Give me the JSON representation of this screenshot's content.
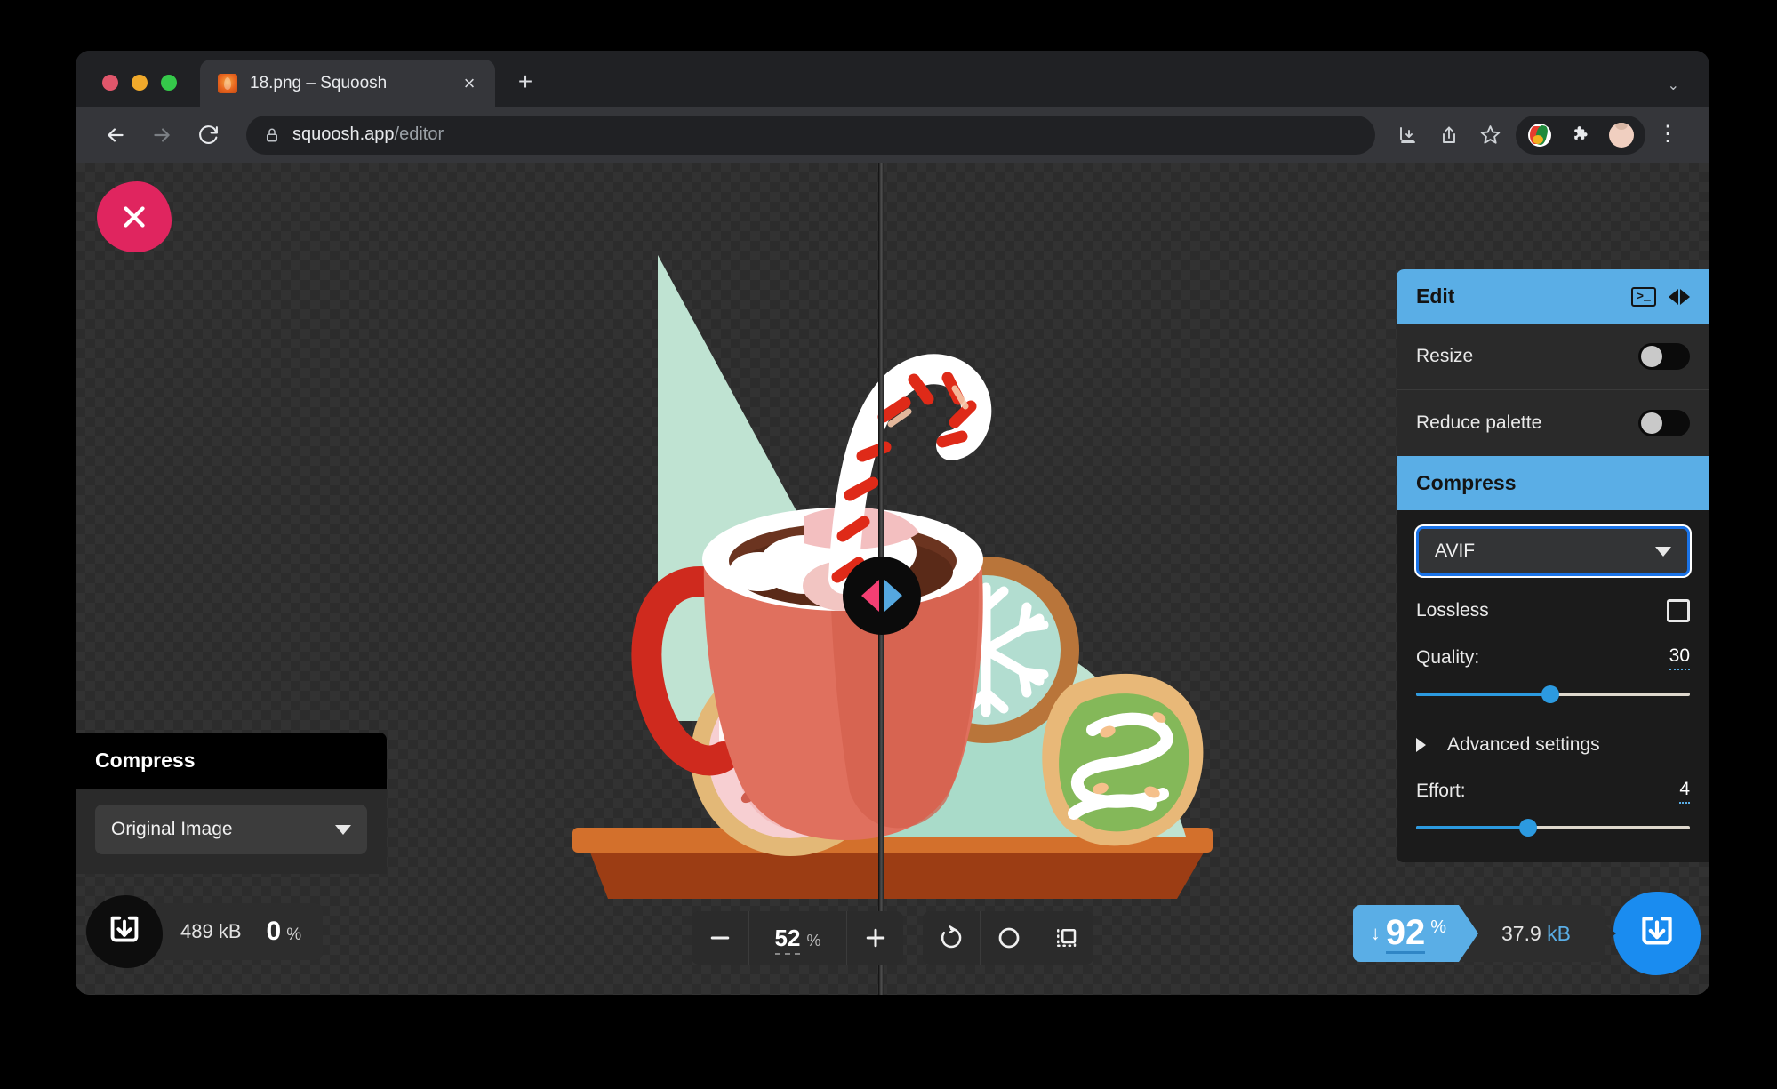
{
  "browser": {
    "tab": {
      "title": "18.png – Squoosh",
      "favicon": "squoosh-favicon",
      "close_label": "×"
    },
    "new_tab_label": "+",
    "window_chevron": "⌄",
    "omnibox": {
      "url_host": "squoosh.app",
      "url_path": "/editor",
      "lock_icon": "lock-icon"
    },
    "toolbar_icons": [
      "install-icon",
      "share-icon",
      "bookmark-star-icon",
      "extension-avatar-icon",
      "puzzle-extensions-icon",
      "profile-avatar-icon",
      "kebab-menu-icon"
    ]
  },
  "app": {
    "close_button_label": "×",
    "split": {
      "left_marker": "pink-triangle",
      "right_marker": "blue-triangle"
    },
    "edit_panel": {
      "title": "Edit",
      "terminal_glyph": ">_",
      "rows": [
        {
          "label": "Resize",
          "control": "toggle",
          "value": "off"
        },
        {
          "label": "Reduce palette",
          "control": "toggle",
          "value": "off"
        }
      ]
    },
    "compress_panel": {
      "title": "Compress",
      "format": "AVIF",
      "lossless": {
        "label": "Lossless",
        "checked": false
      },
      "quality": {
        "label": "Quality:",
        "value": "30",
        "percent": 30
      },
      "advanced": {
        "label": "Advanced settings",
        "expanded": false
      },
      "effort": {
        "label": "Effort:",
        "value": "4",
        "percent": 40
      }
    },
    "left_panel": {
      "title": "Compress",
      "format": "Original Image"
    },
    "original_stats": {
      "size": "489 kB",
      "percent": "0",
      "percent_sign": "%",
      "download_icon": "download-icon"
    },
    "zoom_controls": {
      "minus_label": "−",
      "value": "52",
      "percent_sign": "%",
      "plus_label": "+",
      "buttons": [
        "rotate-icon",
        "circle-icon",
        "background-toggle-icon"
      ]
    },
    "result_stats": {
      "reduction_arrow": "↓",
      "reduction_percent": "92",
      "percent_sign": "%",
      "size_number": "37.9",
      "size_unit": "kB",
      "download_icon": "download-icon"
    }
  },
  "colors": {
    "accent_blue": "#5aaee6",
    "download_blue": "#1a8cf0",
    "close_pink": "#e0255f",
    "panel_dark": "#2a2a2a"
  }
}
